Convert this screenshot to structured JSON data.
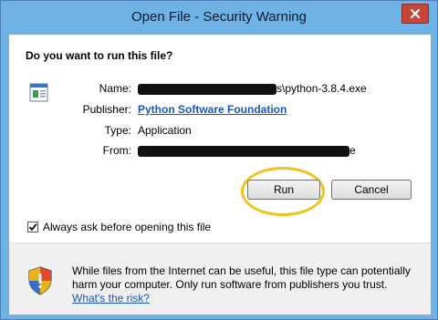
{
  "window": {
    "title": "Open File - Security Warning",
    "close_icon": "close-icon"
  },
  "dialog": {
    "question": "Do you want to run this file?",
    "file_icon": "application-file-icon",
    "fields": {
      "name_label": "Name:",
      "name_value_suffix": "s\\python-3.8.4.exe",
      "publisher_label": "Publisher:",
      "publisher_value": "Python Software Foundation",
      "type_label": "Type:",
      "type_value": "Application",
      "from_label": "From:",
      "from_value_suffix": "e"
    },
    "buttons": {
      "run_label": "Run",
      "cancel_label": "Cancel"
    },
    "checkbox": {
      "label": "Always ask before opening this file",
      "checked": true
    },
    "warning": {
      "icon": "shield-warning-icon",
      "text": "While files from the Internet can be useful, this file type can potentially harm your computer. Only run software from publishers you trust.",
      "link": "What's the risk?"
    }
  },
  "colors": {
    "titlebar": "#6fb3e6",
    "link": "#1a57b8",
    "highlight": "#f2c21a"
  }
}
